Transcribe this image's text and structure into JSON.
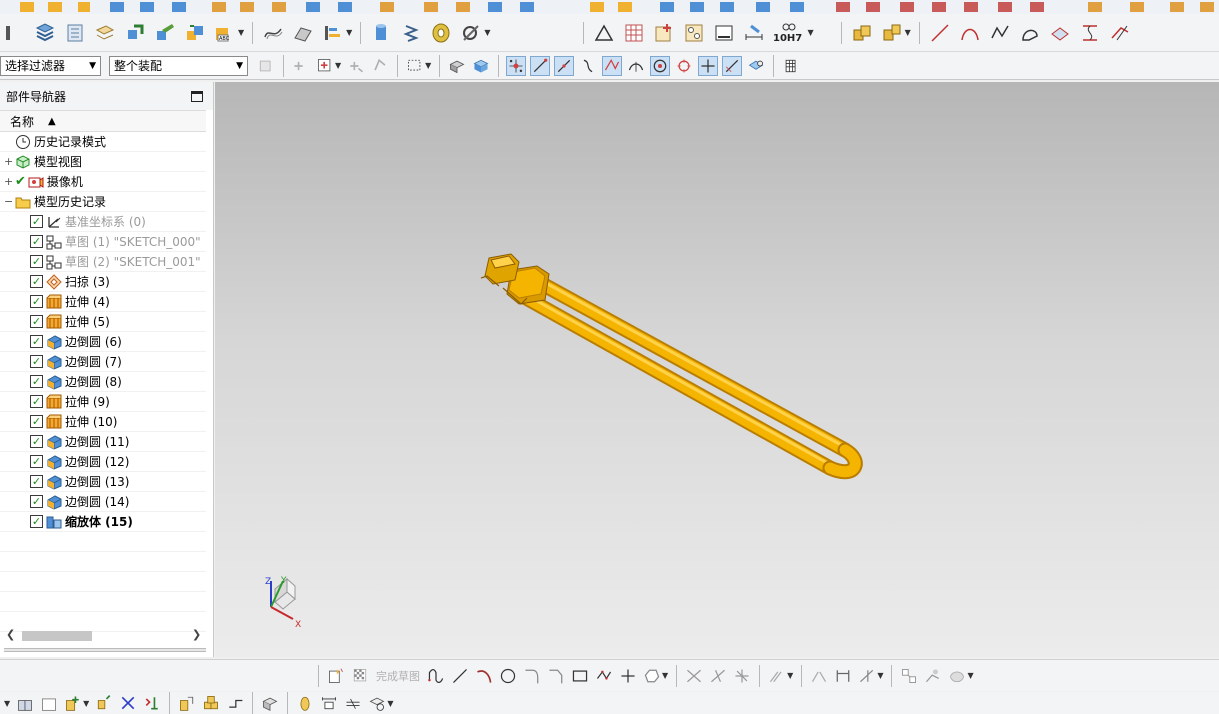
{
  "toolbar": {
    "selection_filter": "选择过滤器",
    "assembly_scope": "整个装配",
    "fit_class": "10H7"
  },
  "navigator": {
    "title": "部件导航器",
    "column_name": "名称",
    "sort_indicator": "▲",
    "items": [
      {
        "label": "历史记录模式",
        "icon": "clock-icon"
      },
      {
        "label": "模型视图",
        "icon": "model-views-icon",
        "expander": "+"
      },
      {
        "label": "摄像机",
        "icon": "camera-icon",
        "expander": "+"
      },
      {
        "label": "模型历史记录",
        "icon": "folder-icon",
        "expander": "−"
      }
    ],
    "features": [
      {
        "label": "基准坐标系 (0)",
        "icon": "datum-csys-icon",
        "state": "disabled"
      },
      {
        "label": "草图 (1) \"SKETCH_000\"",
        "icon": "sketch-icon",
        "state": "disabled"
      },
      {
        "label": "草图 (2) \"SKETCH_001\"",
        "icon": "sketch-icon",
        "state": "disabled"
      },
      {
        "label": "扫掠 (3)",
        "icon": "sweep-icon",
        "state": "normal"
      },
      {
        "label": "拉伸 (4)",
        "icon": "extrude-icon",
        "state": "normal"
      },
      {
        "label": "拉伸 (5)",
        "icon": "extrude-icon",
        "state": "normal"
      },
      {
        "label": "边倒圆 (6)",
        "icon": "edge-blend-icon",
        "state": "normal"
      },
      {
        "label": "边倒圆 (7)",
        "icon": "edge-blend-icon",
        "state": "normal"
      },
      {
        "label": "边倒圆 (8)",
        "icon": "edge-blend-icon",
        "state": "normal"
      },
      {
        "label": "拉伸 (9)",
        "icon": "extrude-icon",
        "state": "normal"
      },
      {
        "label": "拉伸 (10)",
        "icon": "extrude-icon",
        "state": "normal"
      },
      {
        "label": "边倒圆 (11)",
        "icon": "edge-blend-icon",
        "state": "normal"
      },
      {
        "label": "边倒圆 (12)",
        "icon": "edge-blend-icon",
        "state": "normal"
      },
      {
        "label": "边倒圆 (13)",
        "icon": "edge-blend-icon",
        "state": "normal"
      },
      {
        "label": "边倒圆 (14)",
        "icon": "edge-blend-icon",
        "state": "normal"
      },
      {
        "label": "缩放体 (15)",
        "icon": "scale-body-icon",
        "state": "current"
      }
    ]
  },
  "viewport": {
    "triad": {
      "x_label": "X",
      "y_label": "Y",
      "z_label": "Z"
    }
  },
  "sketch_bar": {
    "finish_sketch": "完成草图"
  },
  "colors": {
    "part": "#f4b400",
    "part_shadow": "#b97d00",
    "check": "#1c8a1c",
    "viewport_top": "#b6b6b6",
    "viewport_bottom": "#ececec"
  }
}
